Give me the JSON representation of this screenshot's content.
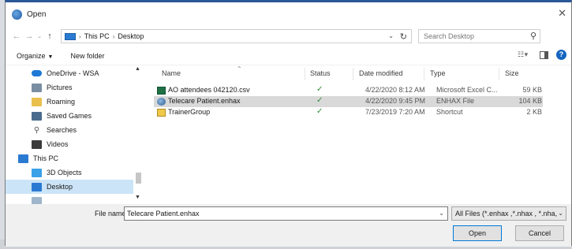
{
  "window": {
    "title": "Open"
  },
  "address": {
    "crumbs": [
      "This PC",
      "Desktop"
    ],
    "separator": "›"
  },
  "search": {
    "placeholder": "Search Desktop"
  },
  "toolbar": {
    "organize_label": "Organize",
    "new_folder_label": "New folder"
  },
  "nav_items": [
    {
      "label": "OneDrive - WSA",
      "icon": "cloud-icon",
      "color": "#1e78d6"
    },
    {
      "label": "Pictures",
      "icon": "pictures-icon",
      "color": "#7a8ea3"
    },
    {
      "label": "Roaming",
      "icon": "folder-icon",
      "color": "#e9c04d"
    },
    {
      "label": "Saved Games",
      "icon": "saved-games-icon",
      "color": "#4a6b8c"
    },
    {
      "label": "Searches",
      "icon": "search-icon",
      "color": "#5a5a5a"
    },
    {
      "label": "Videos",
      "icon": "videos-icon",
      "color": "#3b3b3b"
    },
    {
      "label": "This PC",
      "icon": "pc-icon",
      "color": "#2a7ad2"
    },
    {
      "label": "3D Objects",
      "icon": "cube-icon",
      "color": "#3aa0e8"
    },
    {
      "label": "Desktop",
      "icon": "desktop-icon",
      "color": "#2a7ad2",
      "selected": true
    }
  ],
  "columns": {
    "name": "Name",
    "status": "Status",
    "date": "Date modified",
    "type": "Type",
    "size": "Size"
  },
  "files": [
    {
      "name": "AO attendees 042120.csv",
      "status": "✓",
      "date": "4/22/2020 8:12 AM",
      "type": "Microsoft Excel C...",
      "size": "59 KB",
      "icon": "excel-icon",
      "selected": false
    },
    {
      "name": "Telecare Patient.enhax",
      "status": "✓",
      "date": "4/22/2020 9:45 PM",
      "type": "ENHAX File",
      "size": "104 KB",
      "icon": "enhax-icon",
      "selected": true
    },
    {
      "name": "TrainerGroup",
      "status": "✓",
      "date": "7/23/2019 7:20 AM",
      "type": "Shortcut",
      "size": "2 KB",
      "icon": "shortcut-icon",
      "selected": false
    }
  ],
  "footer": {
    "filename_label": "File name:",
    "filename_value": "Telecare Patient.enhax",
    "filter_value": "All Files (*.enhax ,*.nhax , *.nha,",
    "open_label": "Open",
    "cancel_label": "Cancel"
  },
  "colors": {
    "accent": "#0078d7",
    "selection": "#cce4f7",
    "status_ok": "#2e8b3a"
  }
}
